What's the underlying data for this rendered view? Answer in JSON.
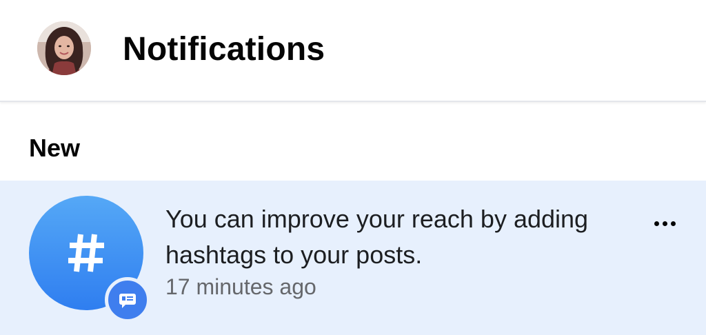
{
  "header": {
    "title": "Notifications"
  },
  "sections": [
    {
      "label": "New",
      "notifications": [
        {
          "text": "You can improve your reach by adding hashtags to your posts.",
          "time": "17 minutes ago",
          "icon": "hashtag-icon",
          "badge_icon": "message-badge-icon",
          "unread": true
        }
      ]
    }
  ],
  "colors": {
    "unread_background": "#e7f0fd",
    "icon_blue": "#2f7ef0",
    "secondary_text": "#65676b"
  }
}
